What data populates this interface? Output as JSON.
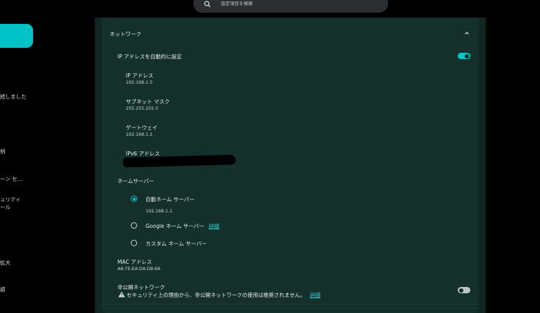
{
  "search": {
    "placeholder": "設定項目を検索"
  },
  "sidebar": {
    "items": [
      {
        "label": "続しました"
      },
      {
        "label": "例"
      },
      {
        "label": "ーン セ…"
      },
      {
        "label": "ュリティ"
      },
      {
        "label": "ール"
      },
      {
        "label": "拡大"
      },
      {
        "label": "語"
      }
    ]
  },
  "network": {
    "section_title": "ネットワーク",
    "auto_ip": {
      "label": "IP アドレスを自動的に設定",
      "enabled": true
    },
    "ip_address": {
      "label": "IP アドレス",
      "value": "192.168.1.5"
    },
    "subnet_mask": {
      "label": "サブネット マスク",
      "value": "255.255.255.0"
    },
    "gateway": {
      "label": "ゲートウェイ",
      "value": "192.168.1.1"
    },
    "ipv6": {
      "label": "IPv6 アドレス"
    },
    "name_servers": {
      "label": "ネームサーバー",
      "options": [
        {
          "label": "自動ネーム サーバー",
          "selected": true,
          "detail": "192.168.1.1"
        },
        {
          "label": "Google ネーム サーバー",
          "selected": false,
          "link": "詳細"
        },
        {
          "label": "カスタム ネーム サーバー",
          "selected": false
        }
      ]
    },
    "mac": {
      "label": "MAC アドレス",
      "value": "A8:7E:EA:DA:D8:6A"
    },
    "hidden_network": {
      "label": "非公開ネットワーク",
      "warning": "セキュリティ上の理由から、非公開ネットワークの使用は推奨されません。",
      "link": "詳細",
      "enabled": false
    }
  },
  "colors": {
    "accent": "#00c6c8",
    "card": "#14302b",
    "panel": "#0f2622",
    "background": "#000000"
  }
}
